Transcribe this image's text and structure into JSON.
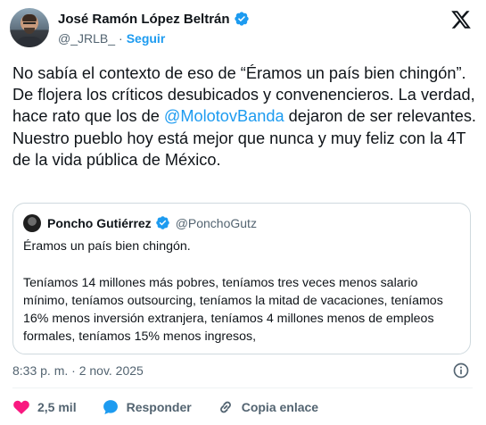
{
  "author": {
    "name": "José Ramón López Beltrán",
    "handle": "@_JRLB_",
    "separator": "·",
    "follow_label": "Seguir"
  },
  "tweet": {
    "text_before": "No sabía el contexto de eso de “Éramos un país bien chingón”. De flojera los críticos desubicados y convenencieros. La verdad, hace rato que los de ",
    "mention": "@MolotovBanda",
    "text_after": " dejaron de ser relevantes. Nuestro pueblo hoy está mejor que nunca y muy feliz con la 4T de la vida pública de México."
  },
  "quoted": {
    "name": "Poncho Gutiérrez",
    "handle": "@PonchoGutz",
    "paragraph1": "Éramos un país bien chingón.",
    "paragraph2": "Teníamos 14 millones más pobres, teníamos tres veces menos salario mínimo, teníamos outsourcing, teníamos la mitad de vacaciones, teníamos 16% menos inversión extranjera, teníamos 4 millones menos de empleos formales, teníamos 15% menos ingresos,"
  },
  "meta": {
    "timestamp": "8:33 p. m. · 2 nov. 2025"
  },
  "actions": {
    "likes": "2,5 mil",
    "reply_label": "Responder",
    "copy_label": "Copia enlace"
  },
  "colors": {
    "accent": "#1d9bf0",
    "like": "#f91880",
    "secondary_text": "#536471"
  },
  "icons": [
    "x-logo-icon",
    "verified-badge-icon",
    "info-icon",
    "heart-icon",
    "reply-bubble-icon",
    "link-icon"
  ]
}
